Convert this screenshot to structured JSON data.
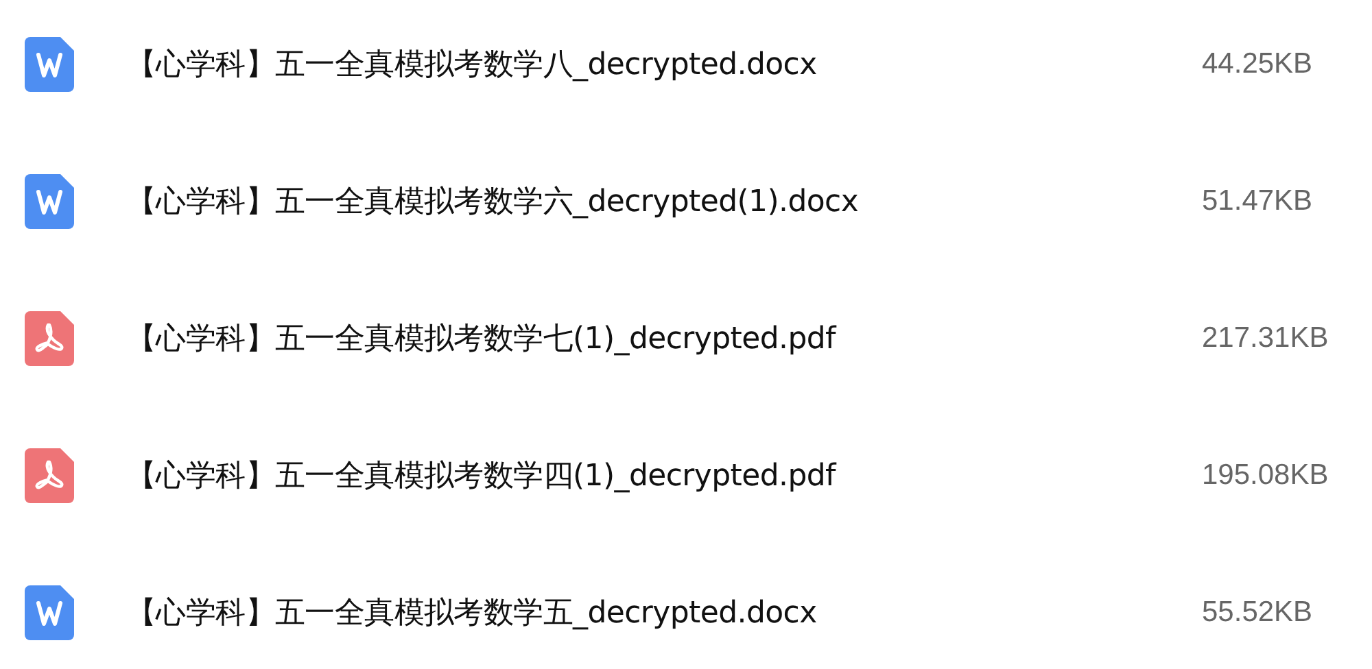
{
  "files": [
    {
      "kind": "word",
      "name": "【心学科】五一全真模拟考数学八_decrypted.docx",
      "size": "44.25KB"
    },
    {
      "kind": "word",
      "name": "【心学科】五一全真模拟考数学六_decrypted(1).docx",
      "size": "51.47KB"
    },
    {
      "kind": "pdf",
      "name": "【心学科】五一全真模拟考数学七(1)_decrypted.pdf",
      "size": "217.31KB"
    },
    {
      "kind": "pdf",
      "name": "【心学科】五一全真模拟考数学四(1)_decrypted.pdf",
      "size": "195.08KB"
    },
    {
      "kind": "word",
      "name": "【心学科】五一全真模拟考数学五_decrypted.docx",
      "size": "55.52KB"
    }
  ]
}
